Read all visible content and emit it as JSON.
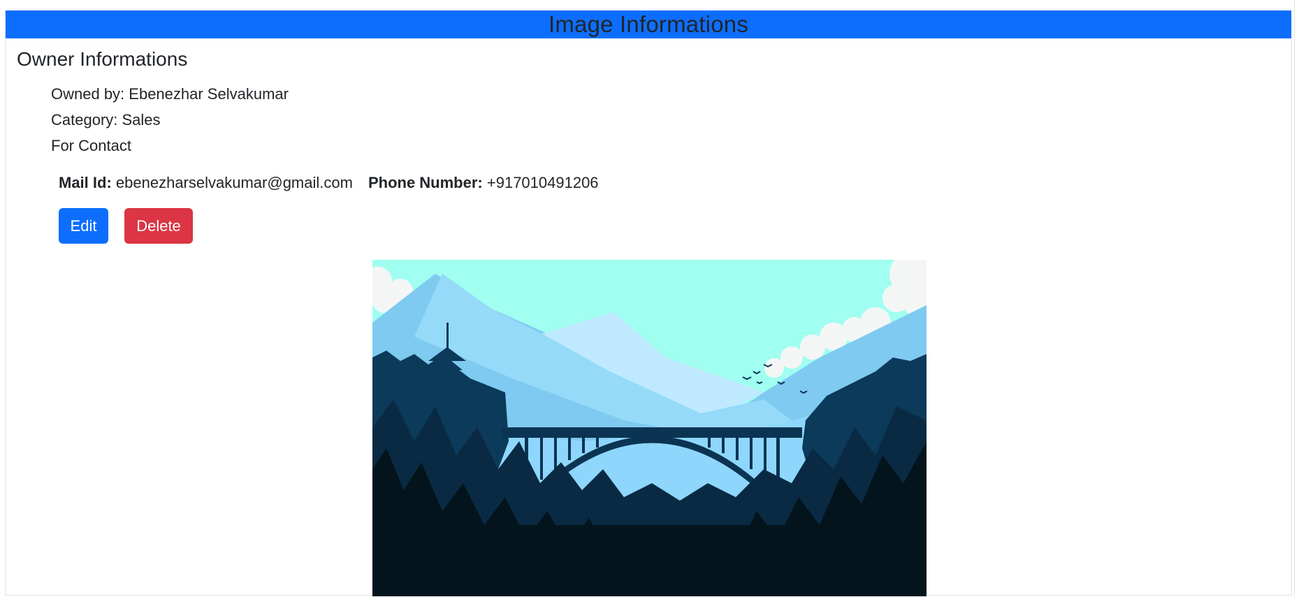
{
  "header": {
    "title": "Image Informations"
  },
  "owner": {
    "section_title": "Owner Informations",
    "owned_by": "Owned by: Ebenezhar Selvakumar",
    "category": "Category: Sales",
    "for_contact": "For Contact",
    "mail_label": "Mail Id:",
    "mail_value": "ebenezharselvakumar@gmail.com",
    "phone_label": "Phone Number:",
    "phone_value": "+917010491206"
  },
  "actions": {
    "edit_label": "Edit",
    "delete_label": "Delete"
  },
  "colors": {
    "primary": "#0d6efd",
    "danger": "#dc3545",
    "sky": "#a0fff0",
    "forest_dark": "#03141c"
  },
  "image": {
    "subject": "illustration of an arch bridge between forested mountains"
  }
}
